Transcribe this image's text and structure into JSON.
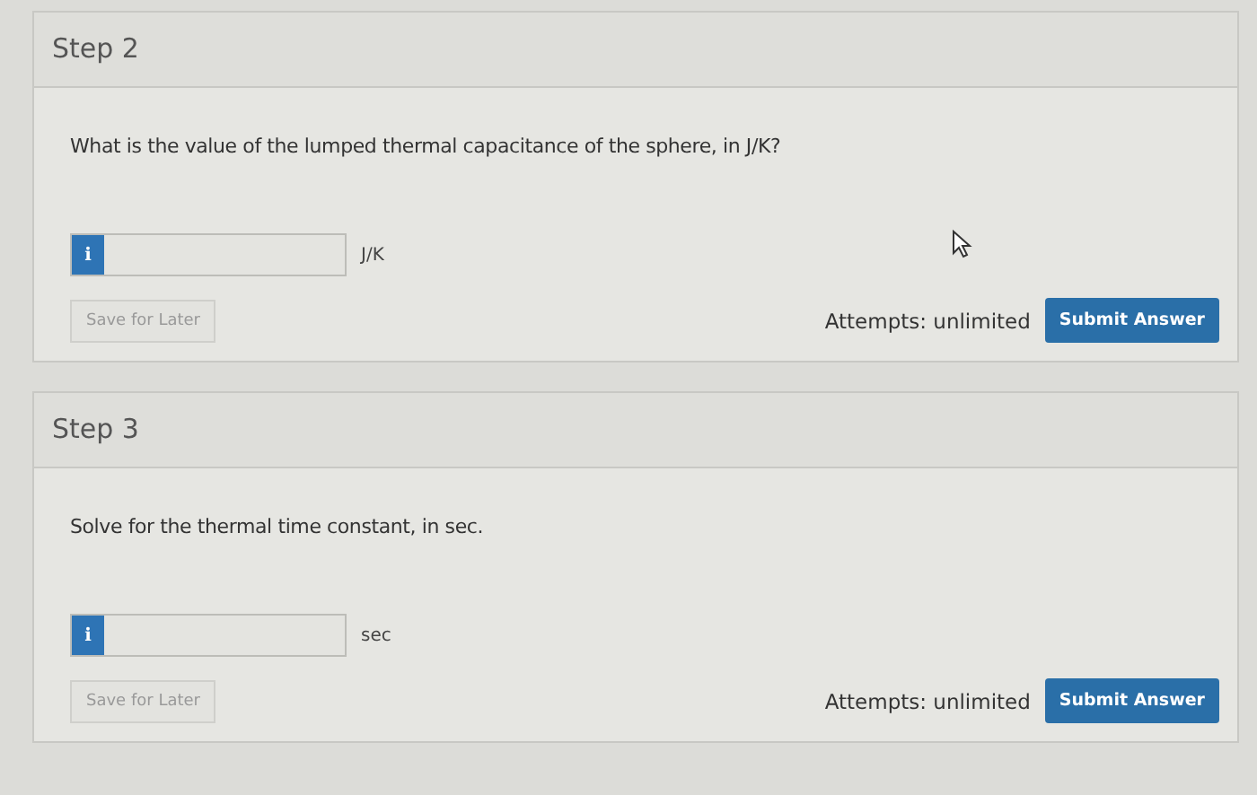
{
  "steps": [
    {
      "title": "Step 2",
      "question": "What is the value of the lumped thermal capacitance of the sphere, in J/K?",
      "info_icon": "i",
      "unit": "J/K",
      "save_button": {
        "label": "Save for Later",
        "disabled": true
      },
      "attempts": "Attempts: unlimited",
      "submit_button": "Submit Answer"
    },
    {
      "title": "Step 3",
      "question": "Solve for the thermal time constant, in sec.",
      "info_icon": "i",
      "unit": "sec",
      "save_button": {
        "label": "Save for Later",
        "disabled": true
      },
      "attempts": "Attempts: unlimited",
      "submit_button": "Submit Answer"
    }
  ]
}
